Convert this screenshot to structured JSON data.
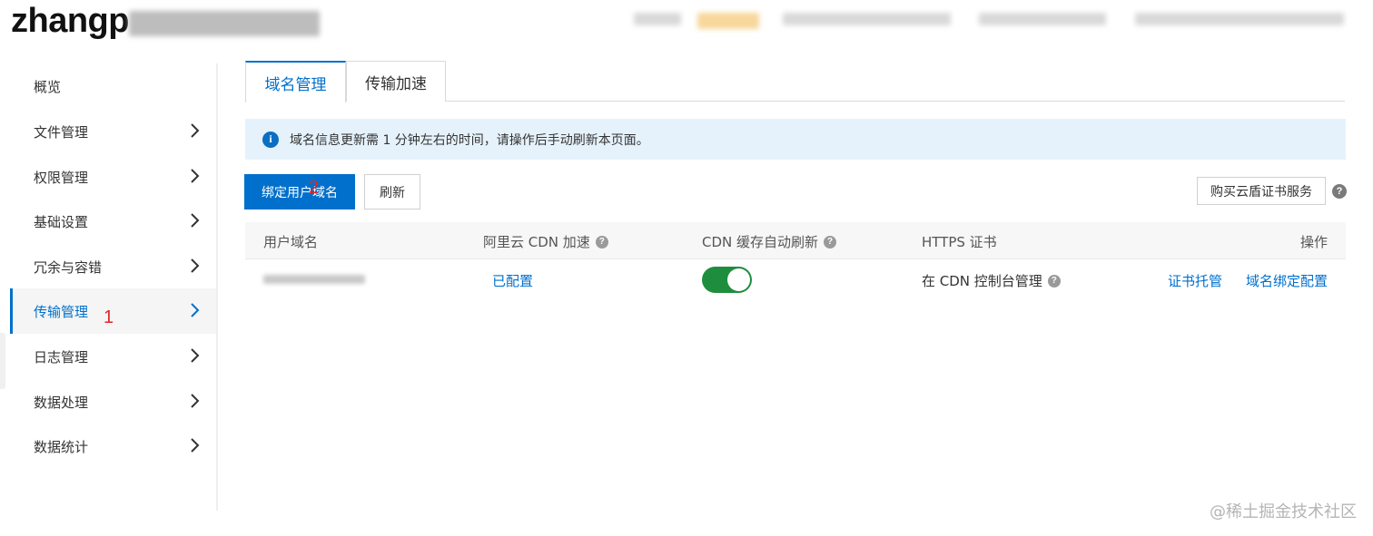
{
  "header": {
    "bucket_name": "zhangp"
  },
  "sidebar": {
    "items": [
      {
        "label": "概览",
        "has_chevron": false
      },
      {
        "label": "文件管理",
        "has_chevron": true
      },
      {
        "label": "权限管理",
        "has_chevron": true
      },
      {
        "label": "基础设置",
        "has_chevron": true
      },
      {
        "label": "冗余与容错",
        "has_chevron": true
      },
      {
        "label": "传输管理",
        "has_chevron": true,
        "active": true
      },
      {
        "label": "日志管理",
        "has_chevron": true
      },
      {
        "label": "数据处理",
        "has_chevron": true
      },
      {
        "label": "数据统计",
        "has_chevron": true
      }
    ],
    "annotation": "1"
  },
  "tabs": [
    {
      "label": "域名管理",
      "active": true
    },
    {
      "label": "传输加速",
      "active": false
    }
  ],
  "info_banner": {
    "icon": "info-icon",
    "text": "域名信息更新需 1 分钟左右的时间，请操作后手动刷新本页面。"
  },
  "toolbar": {
    "bind_domain_label": "绑定用户域名",
    "bind_annotation": "2",
    "refresh_label": "刷新",
    "buy_cert_label": "购买云盾证书服务"
  },
  "table": {
    "columns": {
      "domain": "用户域名",
      "cdn": "阿里云 CDN 加速",
      "cdn_refresh": "CDN 缓存自动刷新",
      "https": "HTTPS 证书",
      "actions": "操作"
    },
    "rows": [
      {
        "cdn_status": "已配置",
        "auto_refresh": true,
        "https": "在 CDN 控制台管理",
        "action_cert": "证书托管",
        "action_bind": "域名绑定配置"
      }
    ]
  },
  "watermark": "@稀土掘金技术社区",
  "colors": {
    "primary": "#0070cc",
    "toggle_on": "#1e8e3e",
    "annotation": "#e0262b",
    "banner_bg": "#e6f2fb"
  }
}
